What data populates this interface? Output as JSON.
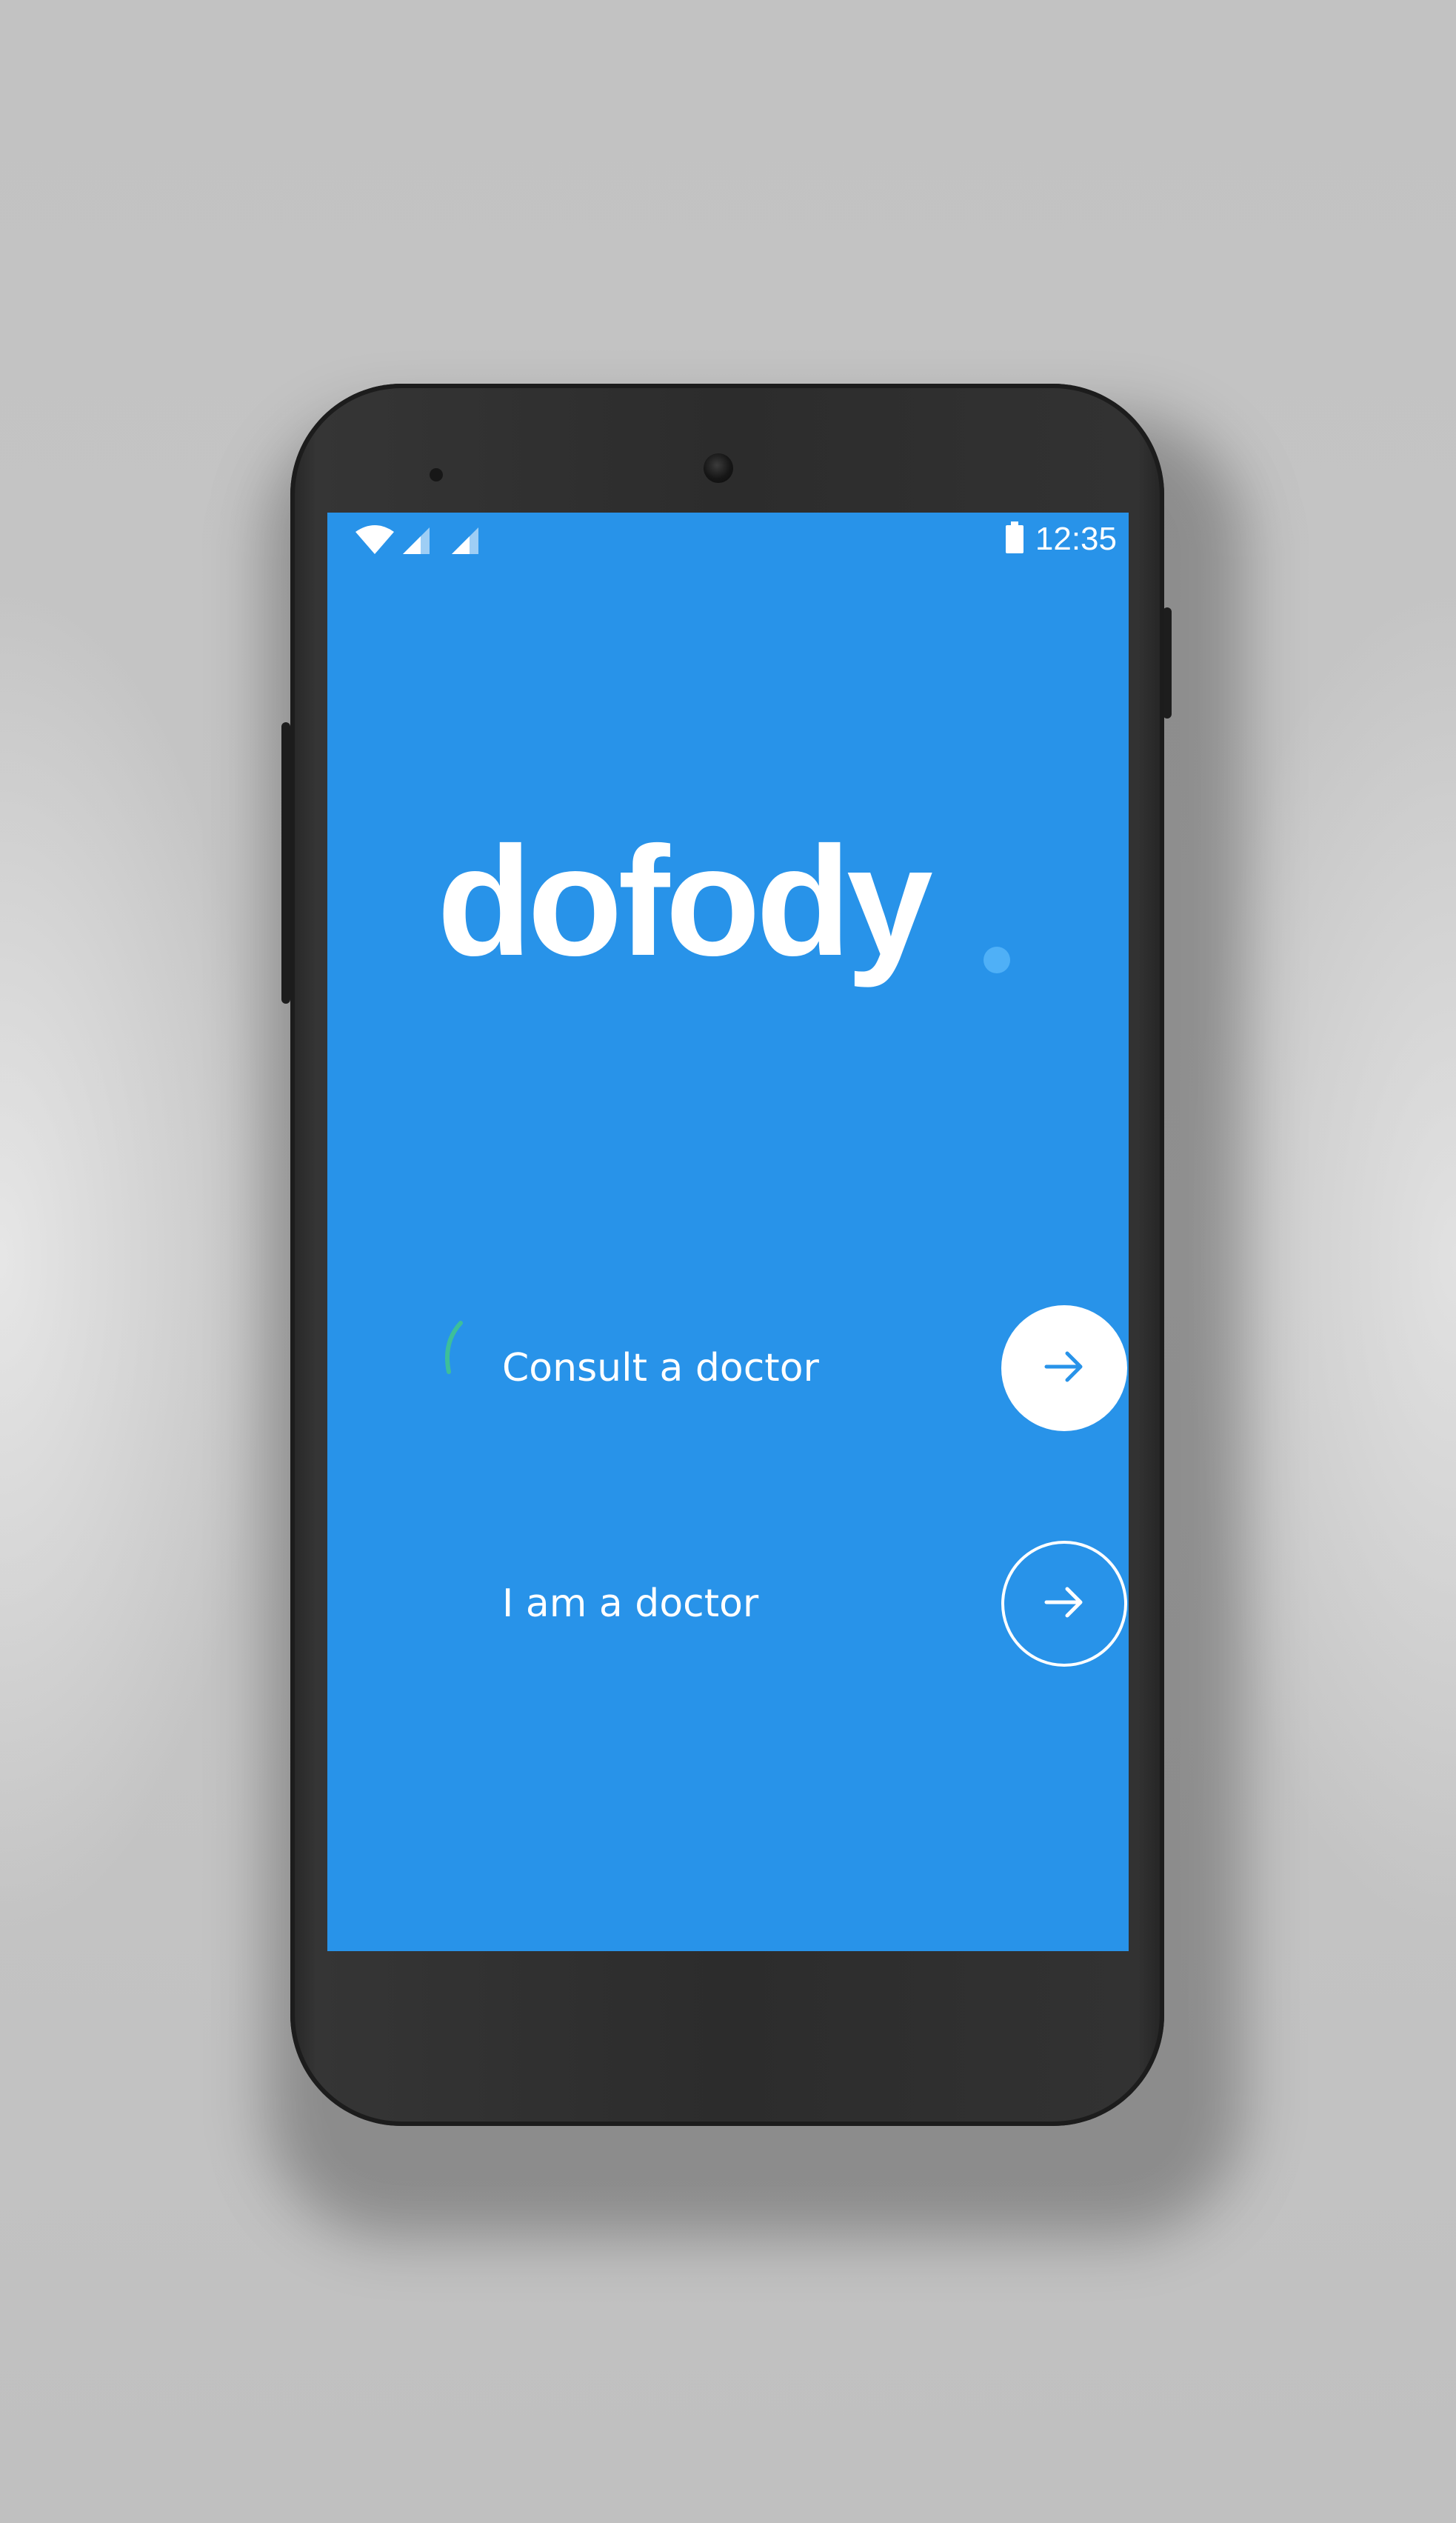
{
  "status_bar": {
    "time": "12:35",
    "icons": [
      "wifi-icon",
      "cellular-signal-icon",
      "cellular-signal-icon",
      "battery-icon"
    ]
  },
  "logo": {
    "text": "dofody"
  },
  "actions": [
    {
      "label": "Consult a doctor",
      "icon": "arrow-right-icon",
      "style": "filled"
    },
    {
      "label": "I am a doctor",
      "icon": "arrow-right-icon",
      "style": "outline"
    }
  ],
  "colors": {
    "screen_background": "#2893e9",
    "logo_dot": "#4fb0f7",
    "accent_arrow": "#2893e9",
    "text": "#ffffff"
  }
}
